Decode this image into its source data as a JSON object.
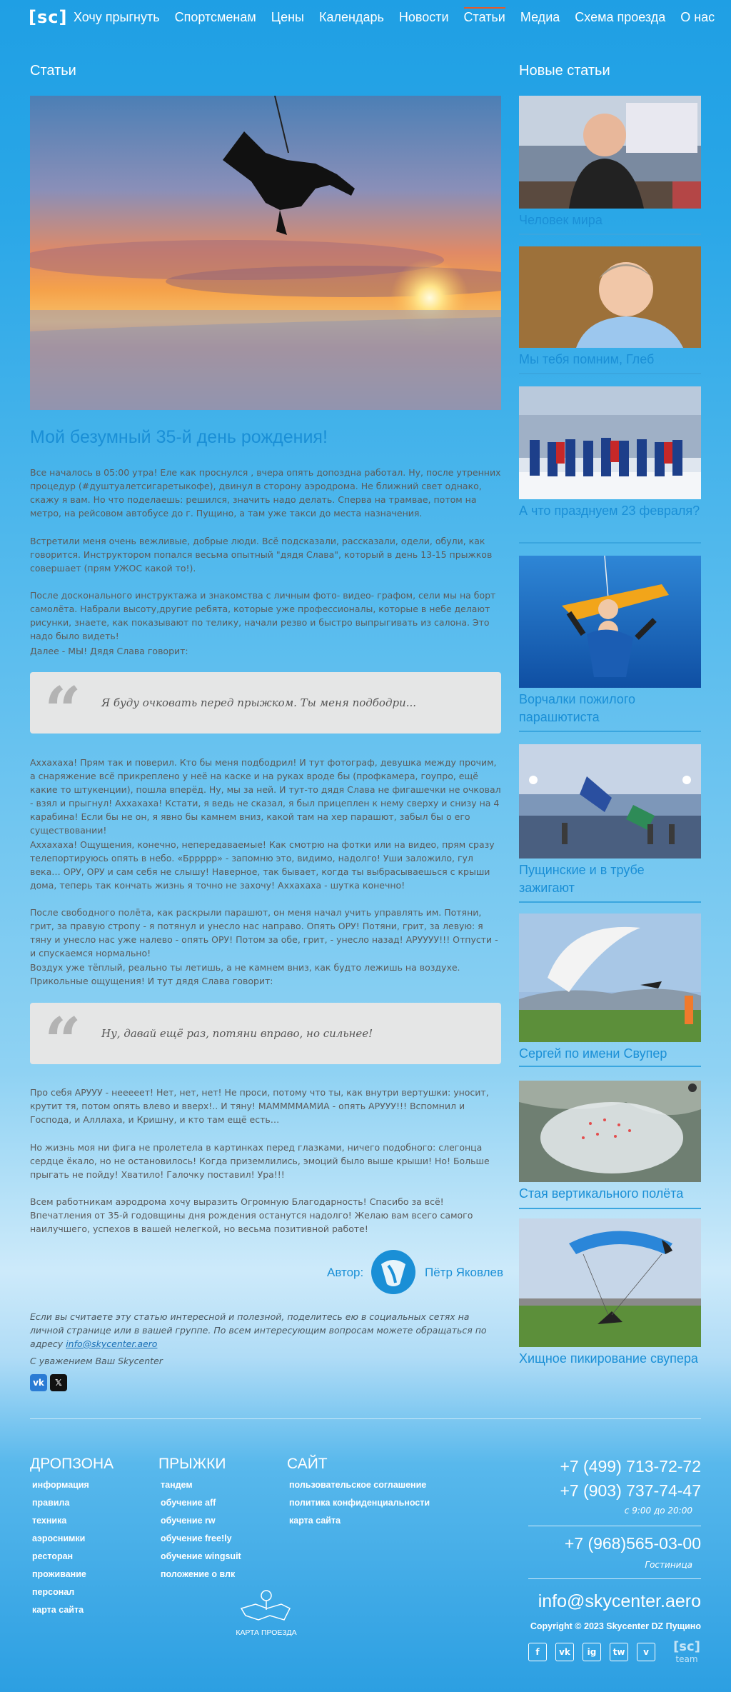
{
  "header": {
    "logo": "[sc]",
    "nav": [
      "Хочу прыгнуть",
      "Спортсменам",
      "Цены",
      "Календарь",
      "Новости",
      "Статьи",
      "Медиа",
      "Схема проезда",
      "О нас"
    ],
    "active": "Статьи"
  },
  "section_title": "Статьи",
  "sidebar_title": "Новые статьи",
  "article": {
    "title": "Мой безумный 35-й день рождения!",
    "p1": "Все началось в 05:00 утра! Еле как проснулся , вчера опять допоздна работал. Ну, после утренних процедур (#душтуалетсигаретыкофе), двинул в сторону аэродрома. Не ближний свет однако, скажу я вам. Но что поделаешь: решился, значить надо делать. Сперва на трамвае, потом на метро, на рейсовом автобусе до г. Пущино, а там уже такси до места назначения.",
    "p2": "Встретили меня очень вежливые, добрые люди. Всё подсказали, рассказали, одели, обули, как говорится. Инструктором попался весьма опытный \"дядя Слава\", который в день 13-15 прыжков совершает (прям УЖОС какой то!).",
    "p3": "После досконального инструктажа и знакомства с личным фото- видео- графом, сели мы на борт самолёта. Набрали высоту,другие ребята, которые уже профессионалы, которые в небе делают рисунки, знаете, как показывают по телику, начали резво и быстро выпрыгивать из салона. Это надо было видеть!",
    "p4": "Далее - МЫ! Дядя Слава говорит:",
    "q1": "Я буду очковать перед прыжком. Ты меня подбодри...",
    "p5": "Аххахаха! Прям так и поверил. Кто бы меня подбодрил! И тут фотограф, девушка между прочим, а снаряжение всё прикреплено у неё на каске и на руках вроде бы (профкамера, гоупро, ещё какие то штукенции), пошла вперёд. Ну, мы за ней. И тут-то дядя Слава не фигашечки не очковал - взял и прыгнул! Аххахаха! Кстати, я ведь не сказал, я был прицеплен к нему сверху и снизу на 4 карабина! Если бы не он, я явно бы камнем вниз, какой там на хер парашют, забыл бы о его существовании!",
    "p6": "Аххахаха! Ощущения, конечно, непередаваемые! Как смотрю на фотки или на видео, прям сразу телепортируюсь опять в небо. «Бррррр» - запомню это, видимо, надолго! Уши заложило, гул века… ОРУ, ОРУ и сам себя не слышу! Наверное, так бывает, когда ты выбрасываешься с крыши дома, теперь так кончать жизнь я точно не захочу! Аххахаха - шутка конечно!",
    "p7": "После свободного полёта, как раскрыли парашют, он меня начал учить управлять им. Потяни, грит, за правую стропу - я потянул и унесло нас направо. Опять ОРУ! Потяни, грит, за левую: я тяну и унесло нас уже налево - опять ОРУ! Потом за обе, грит, - унесло назад! АРУУУУ!!! Отпусти - и спускаемся нормально!",
    "p8": "Воздух уже тёплый, реально ты летишь, а не камнем вниз, как будто лежишь на воздухе. Прикольные ощущения! И тут дядя Слава говорит:",
    "q2": "Ну, давай ещё раз, потяни вправо, но сильнее!",
    "p9": "Про себя АРУУУ - нееееет! Нет, нет, нет! Не проси, потому что ты, как внутри вертушки: уносит, крутит тя, потом опять влево и вверх!.. И тяну! МАММММАМИА - опять АРУУУ!!! Вспомнил и Господа, и Алллаха, и Кришну, и кто там ещё есть…",
    "p10": "Но жизнь моя ни фига не пролетела в картинках перед глазками, ничего подобного: слегонца сердце ёкало, но не остановилось! Когда приземлились, эмоций было выше крыши! Но! Больше прыгать не пойду! Хватило! Галочку поставил! Ура!!!",
    "p11": "Всем работникам аэродрома хочу выразить Огромную Благодарность! Спасибо за всё! Впечатления от 35-й годовщины дня рождения останутся надолго! Желаю вам всего самого наилучшего, успехов в вашей нелегкой, но весьма позитивной работе!",
    "author_label": "Автор:",
    "author_name": "Пётр Яковлев",
    "share": "Если вы считаете эту статью интересной и полезной, поделитесь ею в социальных сетях на личной странице или в вашей группе. По всем интересующим вопросам можете обращаться по адресу",
    "share_mail": "info@skycenter.aero",
    "regards": "С уважением Ваш Skycenter",
    "share_icons": [
      "vk-icon",
      "x-icon"
    ]
  },
  "sidebar": [
    {
      "title": "Человек мира"
    },
    {
      "title": "Мы тебя помним, Глеб"
    },
    {
      "title": "А что празднуем 23 февраля?"
    },
    {
      "title": "Ворчалки пожилого парашютиста"
    },
    {
      "title": "Пущинские и в трубе зажигают"
    },
    {
      "title": "Сергей по имени Свупер"
    },
    {
      "title": "Стая вертикального полёта"
    },
    {
      "title": "Хищное пикирование свупера"
    }
  ],
  "footer": {
    "col1": {
      "title": "Дропзона",
      "links": [
        "информация",
        "правила",
        "техника",
        "аэроснимки",
        "ресторан",
        "проживание",
        "персонал",
        "карта сайта"
      ]
    },
    "col2": {
      "title": "Прыжки",
      "links": [
        "тандем",
        "обучение aff",
        "обучение rw",
        "обучение free!ly",
        "обучение wingsuit",
        "положение о влк"
      ]
    },
    "col3": {
      "title": "Сайт",
      "links": [
        "пользовательское соглашение",
        "политика конфиденциальности",
        "карта сайта"
      ]
    },
    "map_label": "КАРТА ПРОЕЗДА",
    "phone1": "+7 (499) 713-72-72",
    "phone2": "+7 (903) 737-74-47",
    "hours": "с 9:00 до 20:00",
    "phone3": "+7 (968)565-03-00",
    "hotel": "Гостиница",
    "email": "info@skycenter.aero",
    "copyright": "Copyright © 2023 Skycenter DZ Пущино",
    "social": [
      "f",
      "vk",
      "ig",
      "tw",
      "v"
    ],
    "team": "team",
    "team_logo": "[sc]"
  }
}
